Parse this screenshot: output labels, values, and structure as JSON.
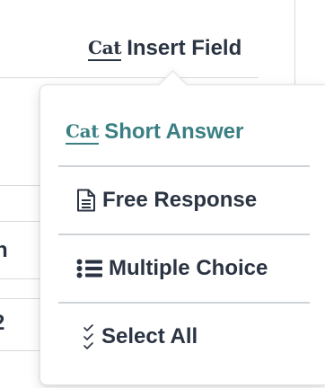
{
  "toolbar": {
    "insert_badge": "Cat",
    "insert_label": "Insert Field"
  },
  "background": {
    "row_fragment_1": "n",
    "row_fragment_2": "2"
  },
  "menu": {
    "items": [
      {
        "badge": "Cat",
        "label": "Short Answer",
        "icon": "cat-badge-icon",
        "active": true
      },
      {
        "label": "Free Response",
        "icon": "document-icon",
        "active": false
      },
      {
        "label": "Multiple Choice",
        "icon": "bulleted-list-icon",
        "active": false
      },
      {
        "label": "Select All",
        "icon": "checklist-icon",
        "active": false
      }
    ]
  },
  "colors": {
    "text_dark": "#2b3442",
    "accent_teal": "#3a7f83",
    "divider": "#cfd3d7",
    "border": "#dfe2e5"
  }
}
